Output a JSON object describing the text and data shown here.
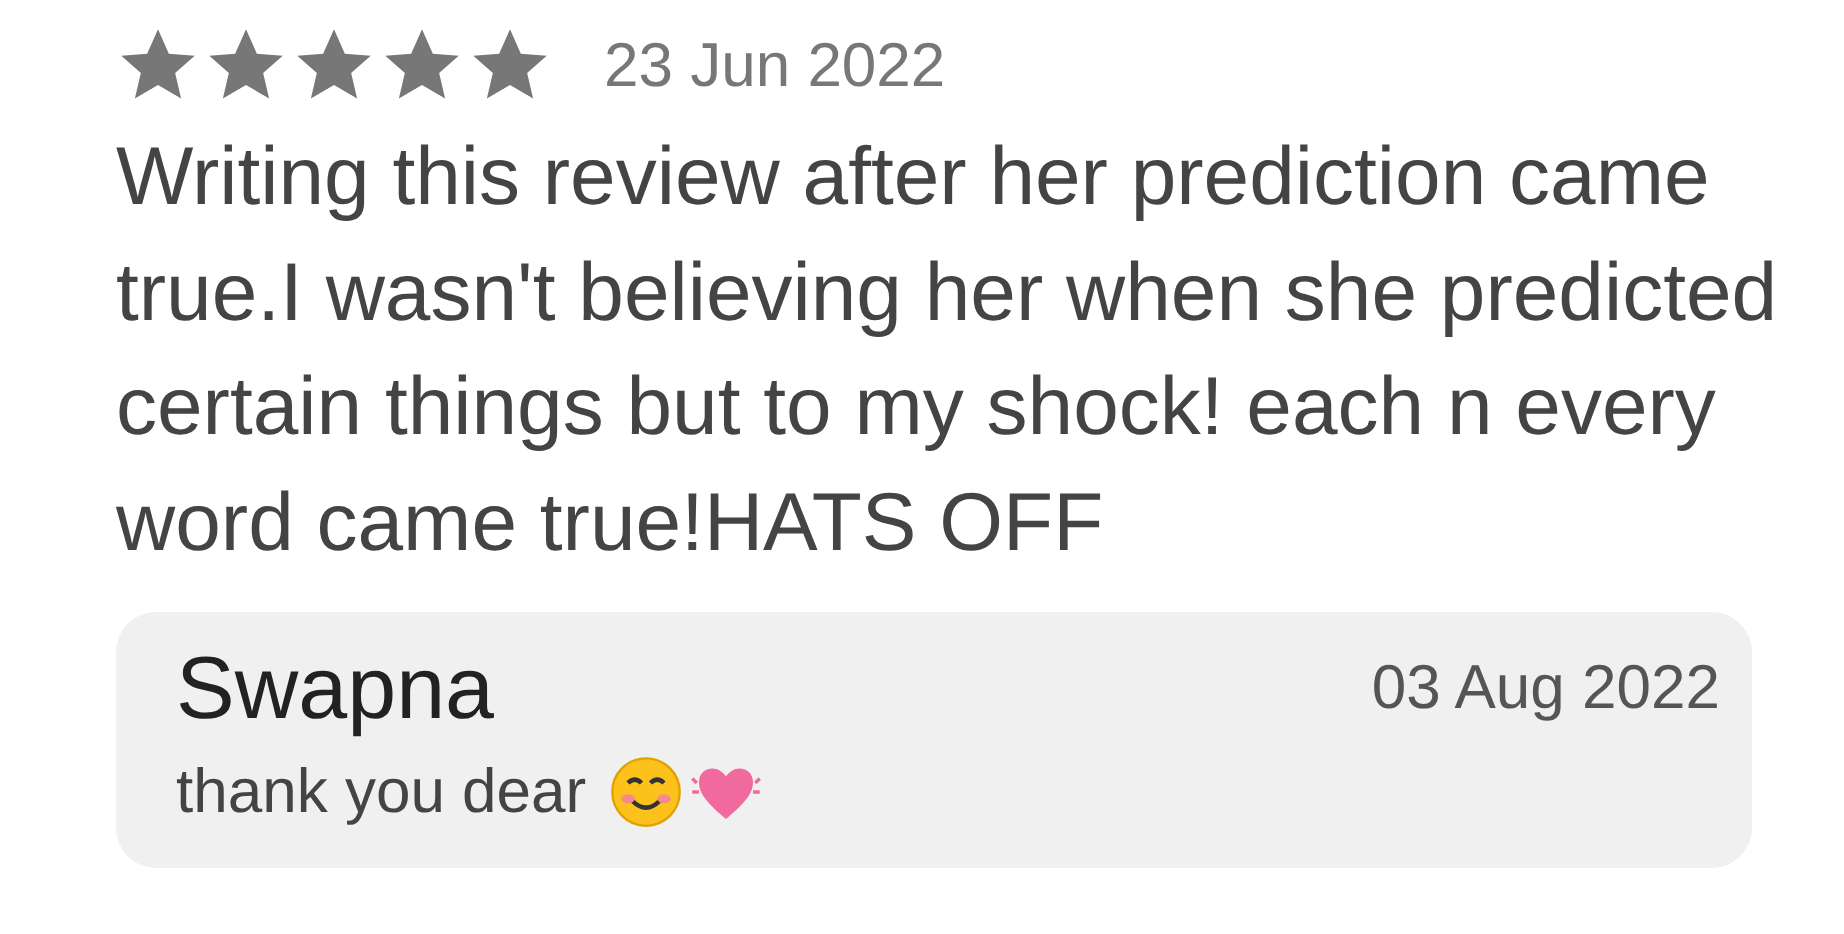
{
  "review": {
    "stars": 5,
    "date": "23 Jun 2022",
    "text": "Writing this review after her prediction came true.I wasn't believing her when she predicted certain things but to my shock! each n every word came true!HATS OFF"
  },
  "reply": {
    "author": "Swapna",
    "date": "03 Aug 2022",
    "text": "thank you dear"
  }
}
